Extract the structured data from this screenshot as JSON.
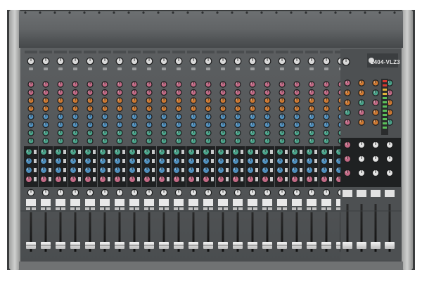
{
  "image": {
    "subject": "mixing-console",
    "background_color": "#ffffff",
    "panel_color": "#55585a",
    "top_cover_color": "#616466",
    "side_rail_color": "#b4b5b4"
  },
  "console": {
    "model_label": "2404-VLZ3",
    "mono_channel_count": 20,
    "stereo_channel_count": 2,
    "knob_colors": {
      "gain": "#d8d8d8",
      "aux_green": "#4aa38a",
      "eq_pink": "#c46a86",
      "eq_orange": "#d07a32",
      "eq_blue": "#4f8fbd",
      "pan": "#e2e2e2"
    }
  }
}
